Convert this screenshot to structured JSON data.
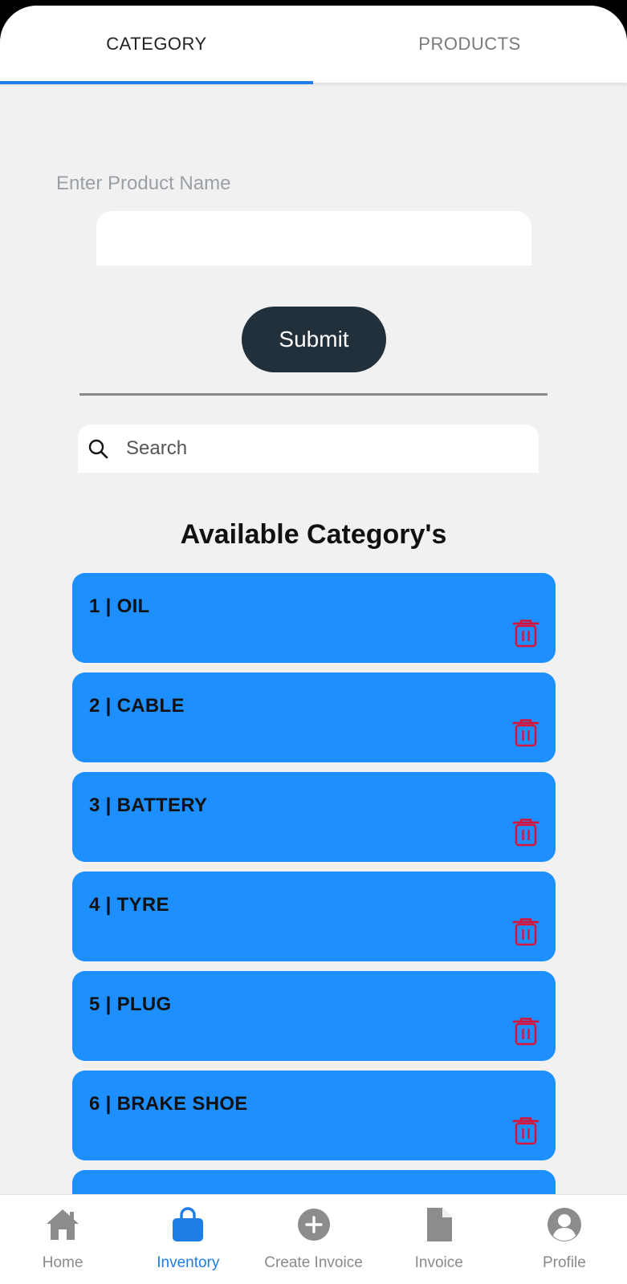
{
  "tabs": [
    {
      "label": "CATEGORY",
      "active": true
    },
    {
      "label": "PRODUCTS",
      "active": false
    }
  ],
  "form": {
    "product_label": "Enter Product Name",
    "product_value": "",
    "submit_label": "Submit"
  },
  "search": {
    "icon": "search-icon",
    "placeholder": "Search",
    "value": ""
  },
  "list": {
    "title": "Available Category's",
    "items": [
      {
        "label": "1 | OIL"
      },
      {
        "label": "2 | CABLE"
      },
      {
        "label": "3 | BATTERY"
      },
      {
        "label": "4 | TYRE"
      },
      {
        "label": "5 | PLUG"
      },
      {
        "label": "6 | BRAKE SHOE"
      },
      {
        "label": ""
      }
    ]
  },
  "nav": [
    {
      "label": "Home",
      "icon": "home-icon"
    },
    {
      "label": "Inventory",
      "icon": "shopping-bag-icon",
      "active": true
    },
    {
      "label": "Create Invoice",
      "icon": "add-circle-icon"
    },
    {
      "label": "Invoice",
      "icon": "document-icon"
    },
    {
      "label": "Profile",
      "icon": "person-circle-icon"
    }
  ],
  "colors": {
    "accent": "#1f7ee6",
    "item_bg": "#1e8fff",
    "delete": "#d6133a",
    "submit_bg": "#22303b",
    "screen_bg": "#f1f1f1"
  }
}
